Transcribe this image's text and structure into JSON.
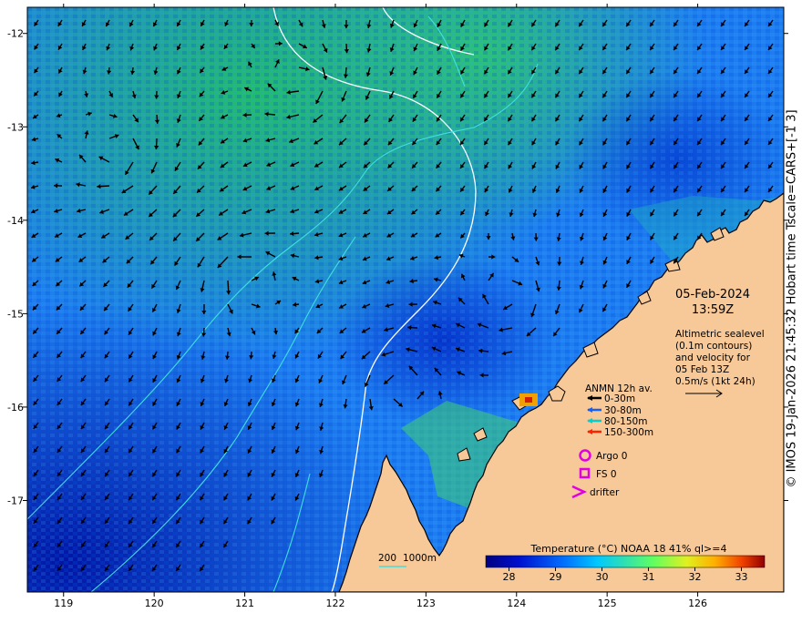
{
  "map": {
    "date": "05-Feb-2024",
    "time": "13:59Z",
    "altimetry_lines": [
      "Altimetric sealevel",
      "(0.1m contours)",
      "and velocity for",
      "05 Feb 13Z",
      "0.5m/s (1kt 24h)"
    ],
    "x_ticks": [
      "119",
      "120",
      "121",
      "122",
      "123",
      "124",
      "125",
      "126"
    ],
    "y_ticks": [
      "-12",
      "-13",
      "-14",
      "-15",
      "-16",
      "-17"
    ],
    "lon_range": [
      118.6,
      126.95
    ],
    "lat_range": [
      -17.98,
      -11.72
    ],
    "anmn": {
      "title": "ANMN 12h av.",
      "items": [
        {
          "label": "0-30m",
          "color": "#000000"
        },
        {
          "label": "30-80m",
          "color": "#1060ff"
        },
        {
          "label": "80-150m",
          "color": "#00d0d0"
        },
        {
          "label": "150-300m",
          "color": "#ff2000"
        }
      ]
    },
    "markers": [
      {
        "label": "Argo 0",
        "icon": "circle-icon",
        "color": "#e000e0"
      },
      {
        "label": "FS 0",
        "icon": "square-icon",
        "color": "#e000e0"
      },
      {
        "label": "drifter",
        "icon": "chevron-icon",
        "color": "#e000e0"
      }
    ],
    "depth_legend": {
      "a": "200",
      "b": "1000m",
      "color": "#40e0e0"
    },
    "colorbar": {
      "title": "Temperature (°C) NOAA 18 41% ql>=4",
      "ticks": [
        "28",
        "29",
        "30",
        "31",
        "32",
        "33"
      ],
      "range": [
        27.5,
        33.5
      ]
    },
    "credit": "© IMOS 19-Jan-2026 21:45:32 Hobart time Tscale=CARS+[-1 3]",
    "colors": {
      "land": "#f7c898",
      "coast": "#000000",
      "sea_level_contour": "#ffffff",
      "shelf_contour": "#40e0e0",
      "magenta": "#e000e0"
    }
  }
}
